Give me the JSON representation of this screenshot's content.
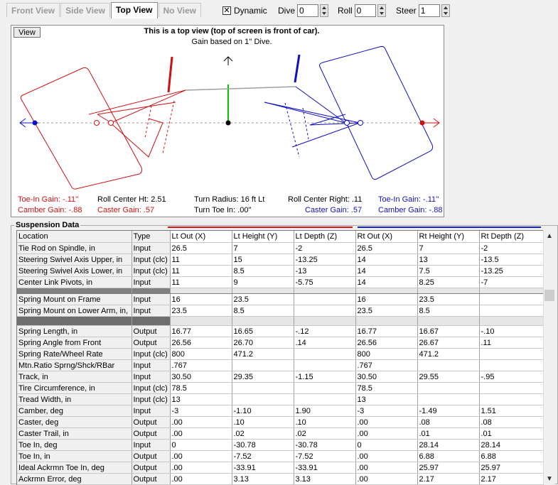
{
  "tabs": [
    {
      "label": "Front View",
      "active": false
    },
    {
      "label": "Side View",
      "active": false
    },
    {
      "label": "Top View",
      "active": true
    },
    {
      "label": "No View",
      "active": false
    }
  ],
  "controls": {
    "dynamic_label": "Dynamic",
    "dynamic_checked": "✕",
    "dive_label": "Dive",
    "dive_value": "0",
    "roll_label": "Roll",
    "roll_value": "0",
    "steer_label": "Steer",
    "steer_value": "1"
  },
  "view": {
    "button_label": "View",
    "title": "This is a top view (top of screen is front of car).",
    "subtitle": "Gain based on 1'' Dive.",
    "toe_in_gain_left": "Toe-In Gain: -.11''",
    "camber_gain_left": "Camber Gain: -.88",
    "roll_center_ht": "Roll Center Ht: 2.51",
    "caster_gain_left": "Caster Gain: .57",
    "turn_radius": "Turn Radius: 16 ft Lt",
    "turn_toe_in": "Turn Toe In: .00''",
    "roll_center_right": "Roll Center Right: .11",
    "caster_gain_right": "Caster Gain: .57",
    "toe_in_gain_right": "Toe-In Gain: -.11''",
    "camber_gain_right": "Camber Gain: -.88",
    "colors": {
      "left": "#d01010",
      "right": "#1010c0",
      "center": "#00c000"
    }
  },
  "suspension": {
    "title": "Suspension Data",
    "headers": [
      "Location",
      "Type",
      "Lt Out (X)",
      "Lt Height (Y)",
      "Lt Depth (Z)",
      "Rt Out (X)",
      "Rt Height (Y)",
      "Rt Depth (Z)"
    ],
    "group1": [
      [
        "Tie Rod on Spindle, in",
        "Input",
        "26.5",
        "7",
        "-2",
        "26.5",
        "7",
        "-2"
      ],
      [
        "Steering Swivel Axis Upper, in",
        "Input (clc)",
        "11",
        "15",
        "-13.25",
        "14",
        "13",
        "-13.5"
      ],
      [
        "Steering Swivel Axis Lower, in",
        "Input (clc)",
        "11",
        "8.5",
        "-13",
        "14",
        "7.5",
        "-13.25"
      ],
      [
        "Center Link Pivots, in",
        "Input",
        "11",
        "9",
        "-5.75",
        "14",
        "8.25",
        "-7"
      ]
    ],
    "group2": [
      [
        "Spring Mount on Frame",
        "Input",
        "16",
        "23.5",
        "",
        "16",
        "23.5",
        ""
      ],
      [
        "Spring Mount on Lower Arm, in,",
        "Input",
        "23.5",
        "8.5",
        "",
        "23.5",
        "8.5",
        ""
      ]
    ],
    "group3": [
      [
        "Spring Length, in",
        "Output",
        "16.77",
        "16.65",
        "-.12",
        "16.77",
        "16.67",
        "-.10"
      ],
      [
        "Spring Angle from Front",
        "Output",
        "26.56",
        "26.70",
        ".14",
        "26.56",
        "26.67",
        ".11"
      ],
      [
        "Spring Rate/Wheel Rate",
        "Input (clc)",
        "800",
        "471.2",
        "",
        "800",
        "471.2",
        ""
      ],
      [
        "Mtn.Ratio Sprng/Shck/RBar",
        "Input",
        ".767",
        "",
        "",
        ".767",
        "",
        ""
      ],
      [
        "Track, in",
        "Input",
        "30.50",
        "29.35",
        "-1.15",
        "30.50",
        "29.55",
        "-.95"
      ],
      [
        "Tire Circumference, in",
        "Input (clc)",
        "78.5",
        "",
        "",
        "78.5",
        "",
        ""
      ],
      [
        "Tread Width, in",
        "Input (clc)",
        "13",
        "",
        "",
        "13",
        "",
        ""
      ],
      [
        "Camber, deg",
        "Input",
        "-3",
        "-1.10",
        "1.90",
        "-3",
        "-1.49",
        "1.51"
      ],
      [
        "Caster, deg",
        "Output",
        ".00",
        ".10",
        ".10",
        ".00",
        ".08",
        ".08"
      ],
      [
        "Caster Trail, in",
        "Output",
        ".00",
        ".02",
        ".02",
        ".00",
        ".01",
        ".01"
      ],
      [
        "Toe In, deg",
        "Input",
        "0",
        "-30.78",
        "-30.78",
        "0",
        "28.14",
        "28.14"
      ],
      [
        "Toe In, in",
        "Output",
        ".00",
        "-7.52",
        "-7.52",
        ".00",
        "6.88",
        "6.88"
      ],
      [
        "Ideal Ackrmn Toe In, deg",
        "Output",
        ".00",
        "-33.91",
        "-33.91",
        ".00",
        "25.97",
        "25.97"
      ],
      [
        "Ackrmn Error, deg",
        "Output",
        ".00",
        "3.13",
        "3.13",
        ".00",
        "2.17",
        "2.17"
      ]
    ]
  }
}
